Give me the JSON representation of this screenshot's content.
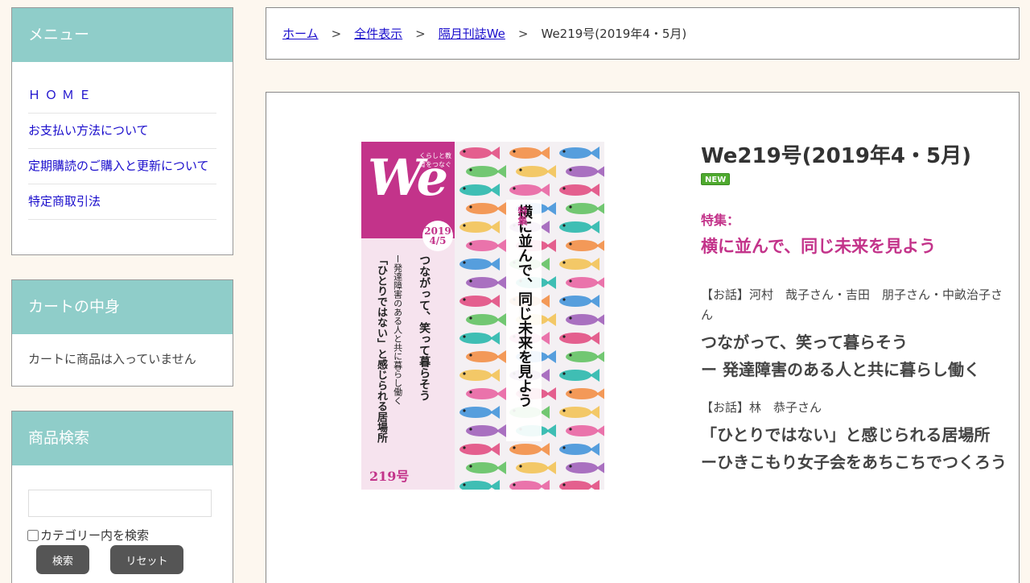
{
  "sidebar": {
    "menu": {
      "title": "メニュー",
      "items": [
        {
          "label": "ＨＯＭＥ"
        },
        {
          "label": "お支払い方法について"
        },
        {
          "label": "定期購読のご購入と更新について"
        },
        {
          "label": "特定商取引法"
        }
      ]
    },
    "cart": {
      "title": "カートの中身",
      "empty_text": "カートに商品は入っていません"
    },
    "search": {
      "title": "商品検索",
      "input_value": "",
      "category_label": "カテゴリー内を検索",
      "search_button": "検索",
      "reset_button": "リセット"
    }
  },
  "breadcrumb": {
    "items": [
      "ホーム",
      "全件表示",
      "隔月刊誌We"
    ],
    "separator": ">",
    "current": "We219号(2019年4・5月)"
  },
  "product": {
    "title": "We219号(2019年4・5月)",
    "badge": "NEW",
    "feature_label": "特集：",
    "feature_title": "横に並んで、同じ未来を見よう",
    "talks": [
      {
        "speakers": "【お話】河村　哉子さん・吉田　朋子さん・中畝治子さん",
        "title_line1": "つながって、笑って暮らそう",
        "title_line2": "ー 発達障害のある人と共に暮らし働く"
      },
      {
        "speakers": "【お話】林　恭子さん",
        "title_line1": "「ひとりではない」と感じられる居場所",
        "title_line2": "ーひきこもり女子会をあちこちでつくろう"
      }
    ]
  },
  "cover": {
    "logo": "We",
    "tagline": "くらしと教育をつなぐ",
    "date": "2019 4/5",
    "feature": "特集",
    "headline": "横に並んで、同じ未来を見よう",
    "story1_title": "つながって、笑って暮らそう",
    "story1_sub": "ー発達障害のある人と共に暮らし働く",
    "story2_title": "「ひとりではない」と感じられる居場所",
    "issue": "219号"
  },
  "colors": {
    "accent": "#8fcdc9",
    "magenta": "#c3338a",
    "link": "#1a0dcc",
    "new_badge": "#4faa2f"
  }
}
